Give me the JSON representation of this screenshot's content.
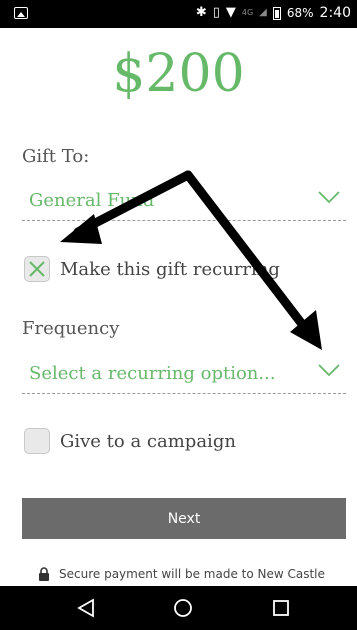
{
  "status_bar": {
    "network": "4G",
    "battery_percent": "68%",
    "time": "2:40"
  },
  "amount": "$200",
  "gift_to": {
    "label": "Gift To:",
    "selected": "General Fund"
  },
  "recurring": {
    "label": "Make this gift recurring",
    "checked": true
  },
  "frequency": {
    "label": "Frequency",
    "selected": "Select a recurring option..."
  },
  "campaign": {
    "label": "Give to a campaign",
    "checked": false
  },
  "next_button": {
    "label": "Next"
  },
  "secure_note": "Secure payment will be made to New Castle",
  "colors": {
    "accent": "#67b96a",
    "button": "#6b6b6b",
    "status_bar": "#000000"
  }
}
